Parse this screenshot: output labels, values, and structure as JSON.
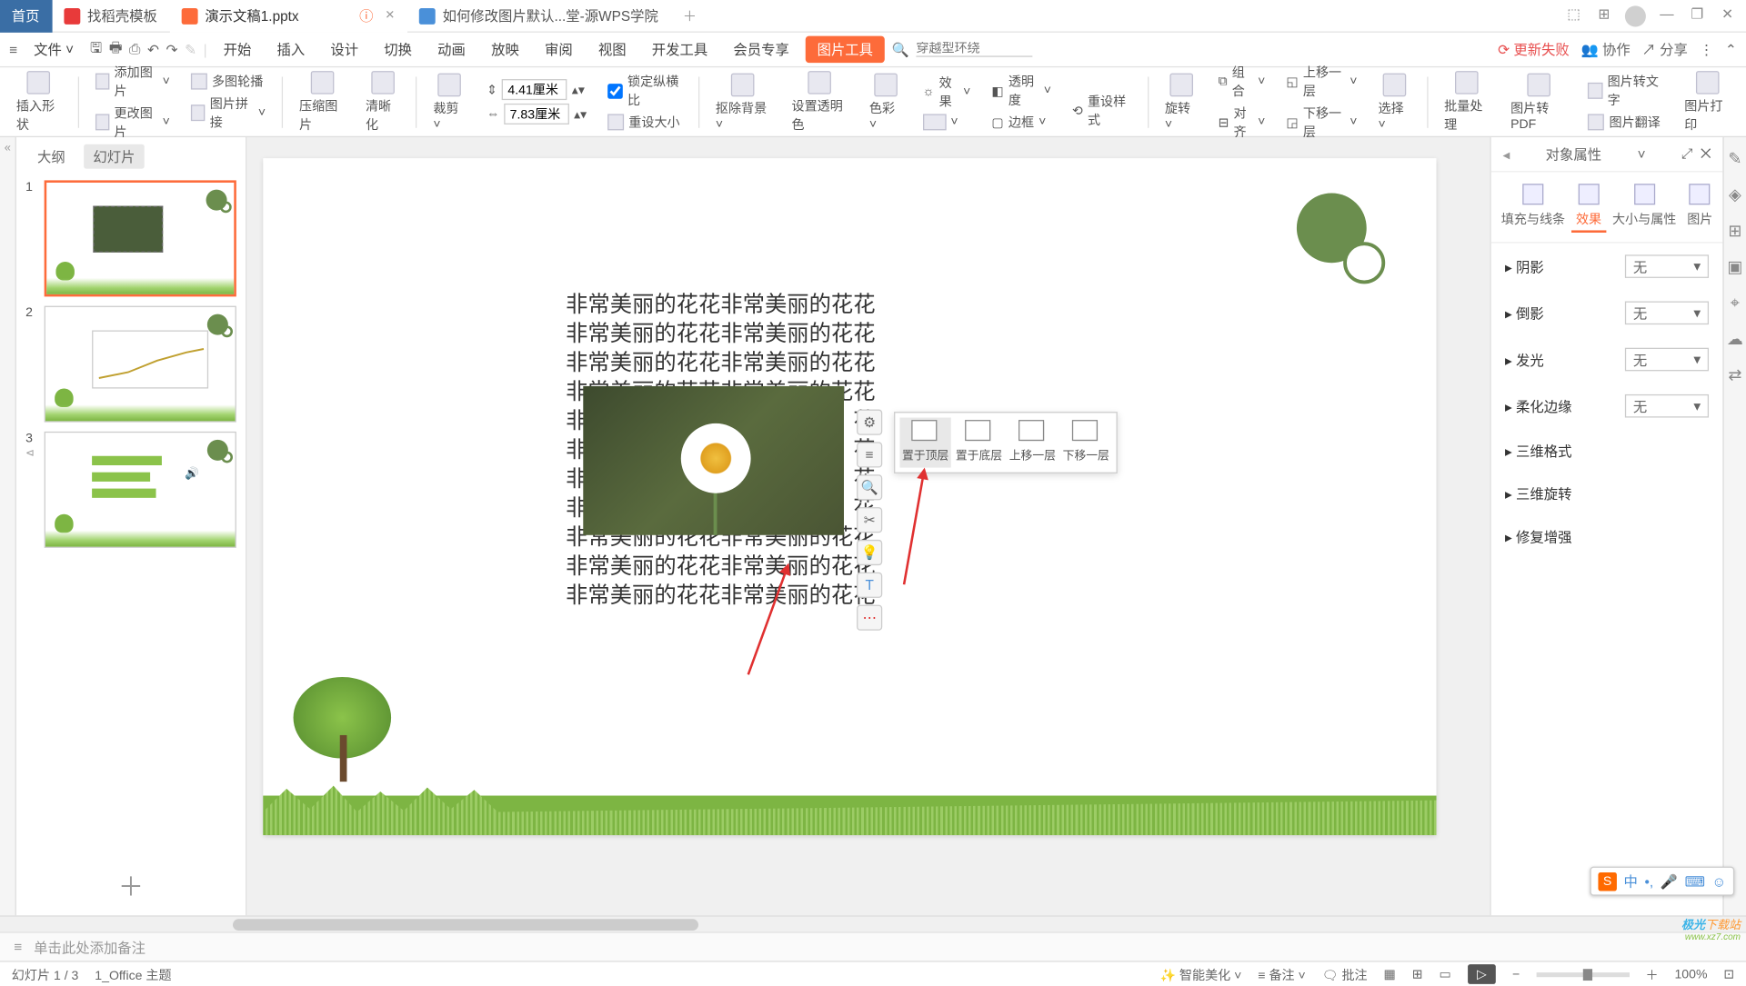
{
  "titlebar": {
    "home": "首页",
    "tab_template": "找稻壳模板",
    "tab_doc": "演示文稿1.pptx",
    "tab_help": "如何修改图片默认...堂-源WPS学院"
  },
  "menubar": {
    "file": "文件",
    "items": [
      "开始",
      "插入",
      "设计",
      "切换",
      "动画",
      "放映",
      "审阅",
      "视图",
      "开发工具",
      "会员专享"
    ],
    "pill": "图片工具",
    "search_placeholder": "穿越型环绕",
    "update_fail": "更新失败",
    "collab": "协作",
    "share": "分享"
  },
  "ribbon": {
    "insert_shape": "插入形状",
    "add_image": "添加图片",
    "change_image": "更改图片",
    "multi_outline": "多图轮播",
    "image_stitch": "图片拼接",
    "compress": "压缩图片",
    "clarify": "清晰化",
    "crop": "裁剪",
    "width": "4.41厘米",
    "height": "7.83厘米",
    "lock_ratio": "锁定纵横比",
    "reset_size": "重设大小",
    "remove_bg": "抠除背景",
    "set_transparent": "设置透明色",
    "color": "色彩",
    "effect": "效果",
    "transparency": "透明度",
    "border": "边框",
    "reset_style": "重设样式",
    "rotate": "旋转",
    "combine": "组合",
    "align": "对齐",
    "bring_forward": "上移一层",
    "send_backward": "下移一层",
    "select": "选择",
    "batch": "批量处理",
    "to_pdf": "图片转PDF",
    "to_text": "图片转文字",
    "translate": "图片翻译",
    "print": "图片打印"
  },
  "slidepanel": {
    "outline": "大纲",
    "slides": "幻灯片"
  },
  "slide": {
    "text_line": "非常美丽的花花非常美丽的花花",
    "text_line_covered": "非常美丽的花花非常美丽的花花"
  },
  "layermenu": {
    "front": "置于顶层",
    "back": "置于底层",
    "forward": "上移一层",
    "backward": "下移一层"
  },
  "proppanel": {
    "title": "对象属性",
    "tab_fill": "填充与线条",
    "tab_effect": "效果",
    "tab_size": "大小与属性",
    "tab_image": "图片",
    "shadow": "阴影",
    "reflection": "倒影",
    "glow": "发光",
    "soft_edge": "柔化边缘",
    "three_d_format": "三维格式",
    "three_d_rotation": "三维旋转",
    "repair": "修复增强",
    "none": "无"
  },
  "notes": {
    "placeholder": "单击此处添加备注"
  },
  "status": {
    "slide_pos": "幻灯片 1 / 3",
    "theme": "1_Office 主题",
    "beautify": "智能美化",
    "notes_btn": "备注",
    "comments_btn": "批注",
    "zoom": "100%"
  },
  "ime": {
    "zh": "中"
  }
}
